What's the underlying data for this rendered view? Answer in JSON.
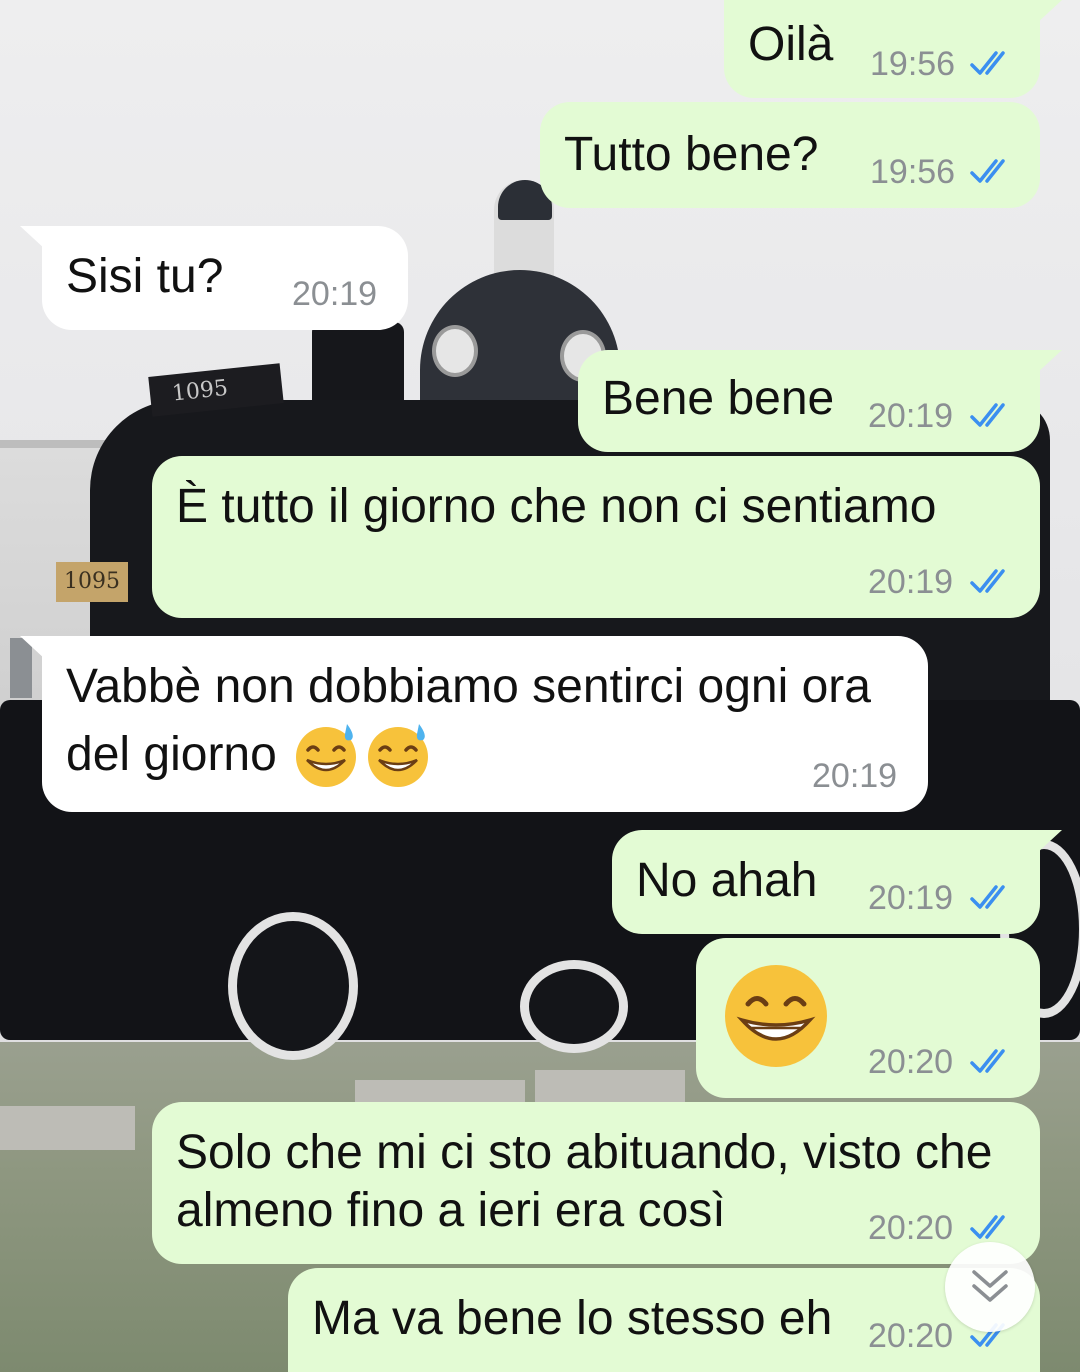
{
  "colors": {
    "outgoing_bubble": "#e3fbd4",
    "incoming_bubble": "#ffffff",
    "timestamp_text": "#8b8f93",
    "read_ticks": "#3b8ff0"
  },
  "messages": [
    {
      "direction": "outgoing",
      "text": "Oilà",
      "time": "19:56",
      "status": "read"
    },
    {
      "direction": "outgoing",
      "text": "Tutto bene?",
      "time": "19:56",
      "status": "read"
    },
    {
      "direction": "incoming",
      "text": "Sisi tu?",
      "time": "20:19"
    },
    {
      "direction": "outgoing",
      "text": "Bene bene",
      "time": "20:19",
      "status": "read"
    },
    {
      "direction": "outgoing",
      "text": "È tutto il giorno che non ci sentiamo",
      "time": "20:19",
      "status": "read"
    },
    {
      "direction": "incoming",
      "text_line1": "Vabbè non dobbiamo sentirci ogni ora",
      "text_line2": "del giorno",
      "emojis": [
        "grinning-face-with-sweat-emoji",
        "grinning-face-with-sweat-emoji"
      ],
      "time": "20:19"
    },
    {
      "direction": "outgoing",
      "text": "No ahah",
      "time": "20:19",
      "status": "read"
    },
    {
      "direction": "outgoing",
      "emoji": "beaming-face-emoji",
      "time": "20:20",
      "status": "read"
    },
    {
      "direction": "outgoing",
      "text_line1": "Solo che mi ci sto abituando, visto che",
      "text_line2": "almeno fino a ieri era così",
      "time": "20:20",
      "status": "read"
    },
    {
      "direction": "outgoing",
      "text": "Ma va bene lo stesso eh",
      "time": "20:20",
      "status": "read"
    }
  ],
  "wallpaper": {
    "engine_number": "1095"
  },
  "scroll_button": {
    "icon": "double-chevron-down-icon"
  }
}
